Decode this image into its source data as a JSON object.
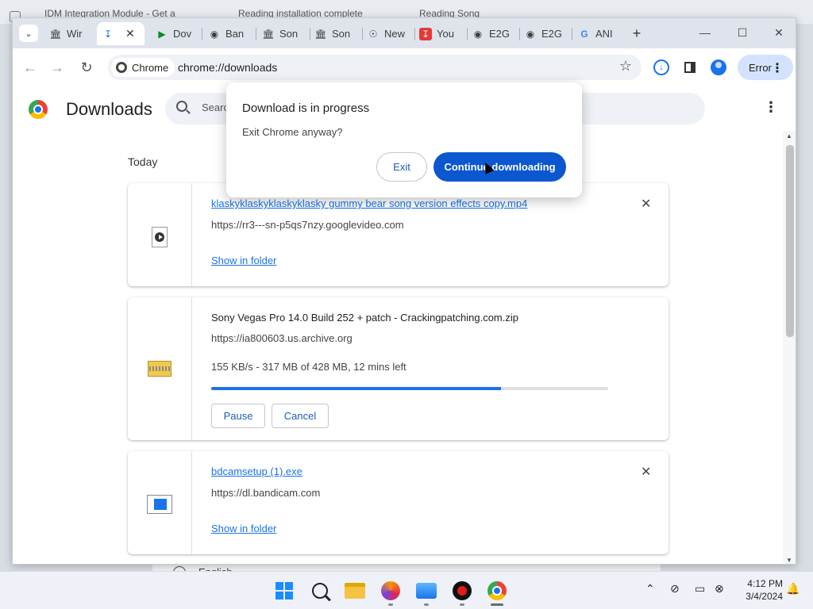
{
  "background": {
    "tabs": [
      "IDM Integration Module - Get a",
      "Reading installation complete",
      "Reading Song"
    ],
    "lower_text": "English"
  },
  "tabs": [
    {
      "label": "Wir",
      "icon": "museum-icon"
    },
    {
      "label": "",
      "icon": "download-icon",
      "active": true
    },
    {
      "label": "Dov",
      "icon": "play-store-icon"
    },
    {
      "label": "Ban",
      "icon": "globe-icon"
    },
    {
      "label": "Son",
      "icon": "museum-icon"
    },
    {
      "label": "Son",
      "icon": "museum-icon"
    },
    {
      "label": "New",
      "icon": "chrome-icon"
    },
    {
      "label": "You",
      "icon": "download-red-icon"
    },
    {
      "label": "E2G",
      "icon": "globe-icon"
    },
    {
      "label": "E2G",
      "icon": "globe-icon"
    },
    {
      "label": "ANI",
      "icon": "google-icon"
    }
  ],
  "toolbar": {
    "chip_label": "Chrome",
    "url": "chrome://downloads",
    "profile_button": "Error"
  },
  "page": {
    "title": "Downloads",
    "search_placeholder": "Search",
    "section_label": "Today"
  },
  "downloads": [
    {
      "name": "klaskyklaskyklaskyklasky gummy bear song version effects copy.mp4",
      "source": "https://rr3---sn-p5qs7nzy.googlevideo.com",
      "action": "Show in folder",
      "icon": "video-file-icon"
    },
    {
      "name": "Sony Vegas Pro 14.0 Build 252 + patch - Crackingpatching.com.zip",
      "source": "https://ia800603.us.archive.org",
      "status": "155 KB/s - 317 MB of 428 MB, 12 mins left",
      "progress_fraction": 0.73,
      "pause_label": "Pause",
      "cancel_label": "Cancel",
      "icon": "zip-file-icon"
    },
    {
      "name": "bdcamsetup (1).exe",
      "source": "https://dl.bandicam.com",
      "action": "Show in folder",
      "icon": "exe-file-icon"
    }
  ],
  "dialog": {
    "title": "Download is in progress",
    "message": "Exit Chrome anyway?",
    "exit_label": "Exit",
    "continue_label": "Continue downloading"
  },
  "taskbar": {
    "time": "4:12 PM",
    "date": "3/4/2024"
  },
  "colors": {
    "accent": "#1a73e8",
    "dialog_primary": "#0b57d0"
  }
}
